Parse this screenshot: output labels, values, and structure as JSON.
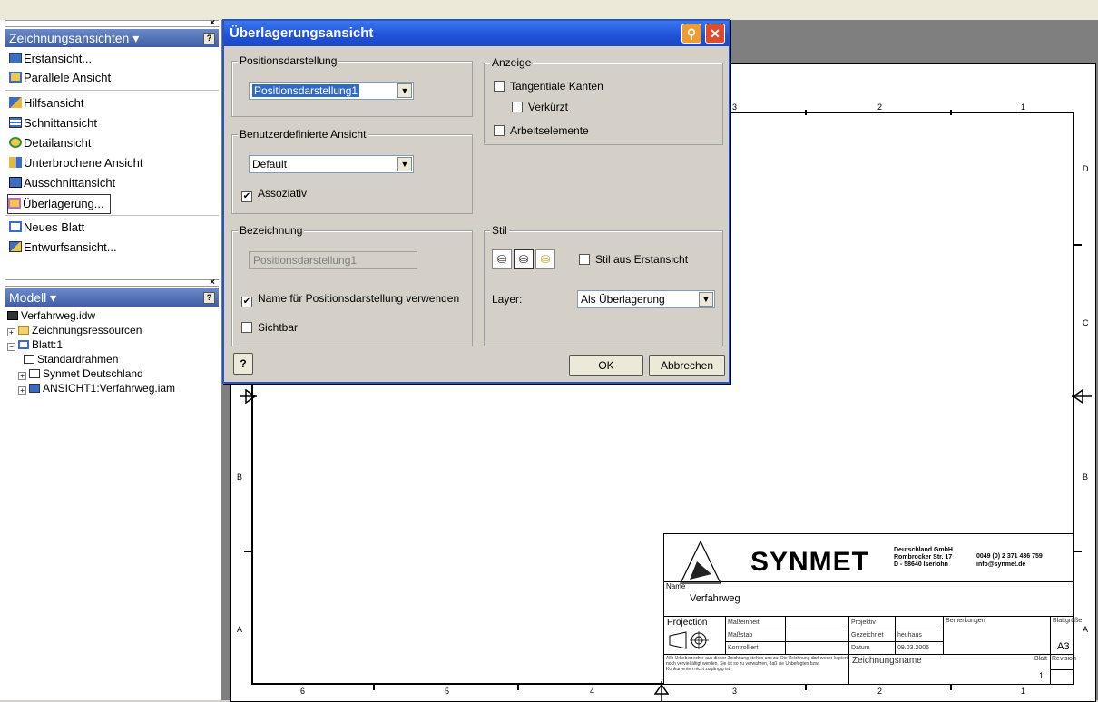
{
  "drawing_browser": {
    "title": "Zeichnungsansichten ▾",
    "commands": [
      "Erstansicht...",
      "Parallele Ansicht",
      "Hilfsansicht",
      "Schnittansicht",
      "Detailansicht",
      "Unterbrochene Ansicht",
      "Ausschnittansicht",
      "Überlagerung...",
      "Neues Blatt",
      "Entwurfsansicht..."
    ]
  },
  "model_browser": {
    "title": "Modell ▾",
    "tree": [
      "Verfahrweg.idw",
      "Zeichnungsressourcen",
      "Blatt:1",
      "Standardrahmen",
      "Synmet Deutschland",
      "ANSICHT1:Verfahrweg.iam"
    ]
  },
  "dialog": {
    "title": "Überlagerungsansicht",
    "position_group": "Positionsdarstellung",
    "position_value": "Positionsdarstellung1",
    "custom_view_group": "Benutzerdefinierte Ansicht",
    "custom_view_value": "Default",
    "associative_label": "Assoziativ",
    "label_group": "Bezeichnung",
    "label_field_value": "Positionsdarstellung1",
    "use_name_label": "Name für Positionsdarstellung verwenden",
    "visible_label": "Sichtbar",
    "display_group": "Anzeige",
    "tangent_label": "Tangentiale Kanten",
    "shortened_label": "Verkürzt",
    "work_features_label": "Arbeitselemente",
    "style_group": "Stil",
    "style_from_base_label": "Stil aus Erstansicht",
    "layer_label": "Layer:",
    "layer_value": "Als Überlagerung",
    "ok_label": "OK",
    "cancel_label": "Abbrechen",
    "help_symbol": "?"
  },
  "sheet": {
    "top_zones": [
      "3",
      "2",
      "1"
    ],
    "bottom_zones": [
      "6",
      "5",
      "4",
      "3",
      "2",
      "1"
    ],
    "right_rows": [
      "D",
      "C",
      "B",
      "A"
    ],
    "left_rows": [
      "B",
      "A"
    ]
  },
  "title_block": {
    "company": "SYNMET",
    "address": [
      "Deutschland GmbH",
      "Rombrocker Str. 17",
      "D - 58640 Iserlohn"
    ],
    "contact": [
      "0049 (0) 2 371 436 759",
      "info@synmet.de"
    ],
    "name_label": "Name",
    "name_value": "Verfahrweg",
    "projection_label": "Projection",
    "unit_label": "Maßeinheit",
    "scale_label": "Maßstab",
    "checked_label": "Kontrolliert",
    "project_label": "Projektiv",
    "drawn_label": "Gezeichnet",
    "drawn_value": "heuhaus",
    "date_label": "Datum",
    "date_value": "09.03.2006",
    "remarks_label": "Bemerkungen",
    "size_label": "Blattgröße",
    "size_value": "A3",
    "copyright": "Alle Urheberrechte aus dieser Zeichnung stehen uns zu. Die Zeichnung darf weder kopiert noch vervielfältigt werden. Sie ist so zu verwahren, daß sie Unbefugten bzw. Konkurrenten nicht zugängig ist.",
    "drawing_name_label": "Zeichnungsname",
    "sheet_label": "Blatt",
    "sheet_value": "1",
    "revision_label": "Revision"
  }
}
